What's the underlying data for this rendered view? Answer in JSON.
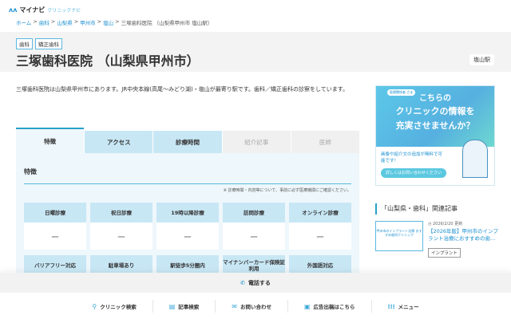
{
  "logo": {
    "brand": "マイナビ",
    "sub": "クリニックナビ"
  },
  "breadcrumb": [
    {
      "label": "ホーム",
      "link": true
    },
    {
      "label": "歯科",
      "link": true
    },
    {
      "label": "山梨県",
      "link": true
    },
    {
      "label": "甲州市",
      "link": true
    },
    {
      "label": "塩山",
      "link": true
    },
    {
      "label": "三塚歯科医院 （山梨県甲州市 塩山駅）",
      "link": false
    }
  ],
  "header": {
    "tags": [
      "歯科",
      "矯正歯科"
    ],
    "title": "三塚歯科医院 （山梨県甲州市）",
    "station": "塩山駅"
  },
  "description": "三塚歯科医院は山梨県甲州市にあります。JR中央本線(高尾～みどり湖)・塩山が最寄り駅です。歯科／矯正歯科の診察をしています。",
  "tabs": [
    {
      "label": "特徴",
      "state": "active"
    },
    {
      "label": "アクセス",
      "state": "normal"
    },
    {
      "label": "診療時間",
      "state": "normal"
    },
    {
      "label": "紹介記事",
      "state": "disabled"
    },
    {
      "label": "医師",
      "state": "disabled"
    }
  ],
  "features": {
    "heading": "特徴",
    "note": "※ 診療時間・内容等について、事前に必ず医療機関にご確認ください。",
    "items": [
      {
        "label": "日曜診療",
        "value": "ー"
      },
      {
        "label": "祝日診療",
        "value": "ー"
      },
      {
        "label": "19時以降診療",
        "value": "ー"
      },
      {
        "label": "訪問診療",
        "value": "ー"
      },
      {
        "label": "オンライン診療",
        "value": "ー"
      },
      {
        "label": "バリアフリー対応",
        "value": ""
      },
      {
        "label": "駐車場あり",
        "value": ""
      },
      {
        "label": "駅徒歩5分圏内",
        "value": ""
      },
      {
        "label": "マイナンバーカード保険証利用",
        "value": ""
      },
      {
        "label": "外国語対応",
        "value": ""
      }
    ]
  },
  "banner": {
    "badge": "医療関係者 さま",
    "line1": "こちらの",
    "line2": "クリニックの情報を",
    "line3": "充実させませんか？",
    "body": "画像や紹介文の追加が無料で可能です！",
    "button": "詳しくはお問い合わせください"
  },
  "related": {
    "heading": "「山梨県・歯科」関連記事",
    "articles": [
      {
        "thumb": "甲州市のインプラント治療 おすすめ歯科クリニック",
        "date": "2026/2/20",
        "date_suffix": "更新",
        "title": "【2026年版】甲州市のインプラント治療におすすめの歯…",
        "tag": "インプラント"
      }
    ]
  },
  "call": {
    "label": "電話する"
  },
  "bottom_nav": [
    {
      "icon": "search-icon",
      "label": "クリニック検索"
    },
    {
      "icon": "document-icon",
      "label": "記事検索"
    },
    {
      "icon": "mail-icon",
      "label": "お問い合わせ"
    },
    {
      "icon": "ad-icon",
      "label": "広告出稿はこちら"
    },
    {
      "icon": "grid-menu-icon",
      "label": "メニュー"
    }
  ],
  "colors": {
    "accent": "#2aa0c8",
    "tab_bg": "#c8e7f5",
    "panel_bg": "#eef7fb"
  }
}
